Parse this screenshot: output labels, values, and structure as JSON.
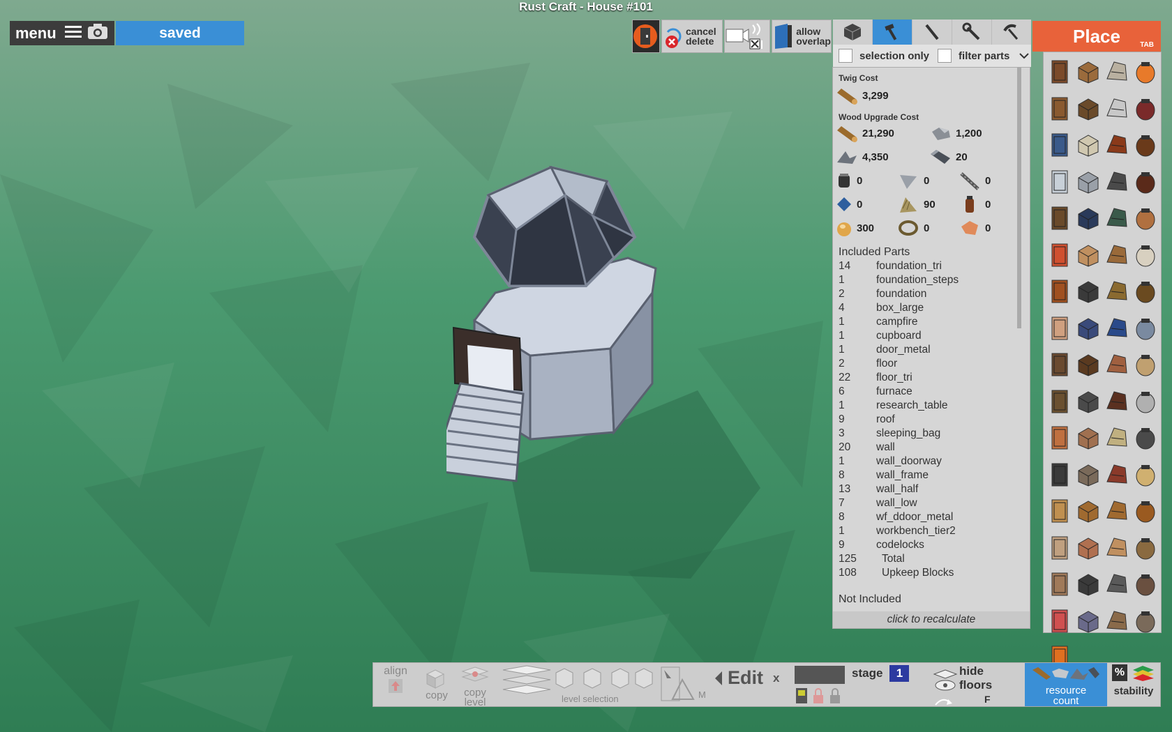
{
  "window": {
    "title": "Rust Craft - House #101"
  },
  "topleft": {
    "menu_label": "menu",
    "saved_label": "saved"
  },
  "toolbar": {
    "cancel_label": "cancel",
    "delete_label": "delete",
    "allow_label": "allow",
    "overlap_label": "overlap"
  },
  "tool_tabs": [
    "cube-icon",
    "hammer-icon",
    "chisel-icon",
    "wrench-icon",
    "pickaxe-icon"
  ],
  "filters": {
    "selection_only": "selection only",
    "filter_parts": "filter parts"
  },
  "costs": {
    "twig_title": "Twig Cost",
    "twig_value": "3,299",
    "wood_title": "Wood Upgrade Cost",
    "wood_rows": [
      {
        "icon": "wood-log-icon",
        "value": "21,290"
      },
      {
        "icon": "stone-icon",
        "value": "1,200"
      },
      {
        "icon": "metal-frags-icon",
        "value": "4,350"
      },
      {
        "icon": "hq-metal-icon",
        "value": "20"
      },
      {
        "icon": "gears-icon",
        "value": "0"
      },
      {
        "icon": "metal-blade-icon",
        "value": "0"
      },
      {
        "icon": "pipe-icon",
        "value": "0"
      },
      {
        "icon": "tarp-icon",
        "value": "0"
      },
      {
        "icon": "cloth-icon",
        "value": "90"
      },
      {
        "icon": "lowgrade-icon",
        "value": "0"
      },
      {
        "icon": "animal-fat-icon",
        "value": "300"
      },
      {
        "icon": "rope-icon",
        "value": "0"
      },
      {
        "icon": "leather-icon",
        "value": "0"
      }
    ]
  },
  "parts": {
    "header": "Included Parts",
    "rows": [
      {
        "n": "14",
        "name": "foundation_tri"
      },
      {
        "n": "1",
        "name": "foundation_steps"
      },
      {
        "n": "2",
        "name": "foundation"
      },
      {
        "n": "4",
        "name": "box_large"
      },
      {
        "n": "1",
        "name": "campfire"
      },
      {
        "n": "1",
        "name": "cupboard"
      },
      {
        "n": "1",
        "name": "door_metal"
      },
      {
        "n": "2",
        "name": "floor"
      },
      {
        "n": "22",
        "name": "floor_tri"
      },
      {
        "n": "6",
        "name": "furnace"
      },
      {
        "n": "1",
        "name": "research_table"
      },
      {
        "n": "9",
        "name": "roof"
      },
      {
        "n": "3",
        "name": "sleeping_bag"
      },
      {
        "n": "20",
        "name": "wall"
      },
      {
        "n": "1",
        "name": "wall_doorway"
      },
      {
        "n": "8",
        "name": "wall_frame"
      },
      {
        "n": "13",
        "name": "wall_half"
      },
      {
        "n": "7",
        "name": "wall_low"
      },
      {
        "n": "8",
        "name": "wf_ddoor_metal"
      },
      {
        "n": "1",
        "name": "workbench_tier2"
      },
      {
        "n": "9",
        "name": "codelocks"
      },
      {
        "n": "125",
        "name": "Total"
      },
      {
        "n": "108",
        "name": "Upkeep Blocks"
      }
    ],
    "not_included": "Not Included",
    "recalc": "click to recalculate"
  },
  "place": {
    "title": "Place",
    "tab_hint": "TAB",
    "items": [
      "door-item",
      "log-item",
      "bed-item",
      "campfire-item",
      "box-item",
      "chest-item",
      "shelves-item",
      "chair-item",
      "cupboard-item",
      "ceiling-light-item",
      "lantern-item",
      "lamp-item",
      "fridge-item",
      "locker-item",
      "table-item",
      "bbq-item",
      "bookcase-item",
      "arcade-item",
      "vending-item",
      "gate-item",
      "barricade-item",
      "sign-item",
      "bench-item",
      "rocking-chair-item",
      "furnace-item",
      "stove-item",
      "bell-item",
      "workbench-item",
      "flag-item",
      "tap-item",
      "tarp-table-item",
      "water-barrel-item",
      "fence-item",
      "wood-wall-item",
      "hut-item",
      "stand-item",
      "spikes-item",
      "barbed-item",
      "frame-item",
      "tent-item",
      "sleeping-bag-item",
      "crate-item",
      "hay-item",
      "chainsaw-item",
      "turret-item",
      "scarecrow-item",
      "trap-item",
      "plank-item",
      "sign-small-item",
      "sign-med-item",
      "sign-large-item",
      "sign-xl-item",
      "picture-item",
      "frame-small-item",
      "panel-item",
      "shelf-item",
      "desk-item",
      "window-item",
      "grill-item",
      "fireplace-item",
      "lights-item",
      "rug-item",
      "bear-rug-item",
      "ladder-item",
      "pumpkin-item"
    ]
  },
  "bottom": {
    "align": "align",
    "copy": "copy",
    "copy_level_1": "copy",
    "copy_level_2": "level",
    "level_selection": "level selection",
    "m_key": "M",
    "edit": "Edit",
    "x": "x",
    "stage": "stage",
    "stage_num": "1",
    "hide": "hide",
    "floors": "floors",
    "f_key": "F",
    "resource": "resource",
    "count": "count",
    "percent": "%",
    "stability": "stability"
  }
}
